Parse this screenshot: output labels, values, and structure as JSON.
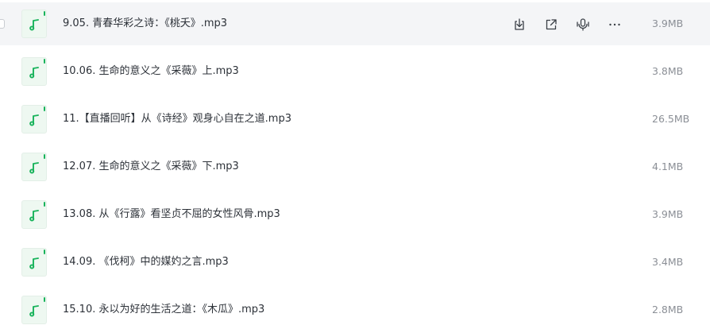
{
  "colors": {
    "accent_green": "#18b35b",
    "icon_bg": "#eef8f1",
    "hover_bg": "#f4f5f7",
    "name_text": "#2c3138",
    "size_text": "#8b8f96"
  },
  "hover_actions": {
    "icons": [
      "download-icon",
      "share-icon",
      "voice-icon",
      "more-icon"
    ]
  },
  "files": [
    {
      "icon": "music-note-icon",
      "name": "9.05. 青春华彩之诗：《桃夭》.mp3",
      "size": "3.9MB",
      "hovered": true
    },
    {
      "icon": "music-note-icon",
      "name": "10.06. 生命的意义之《采薇》上.mp3",
      "size": "3.8MB",
      "hovered": false
    },
    {
      "icon": "music-note-icon",
      "name": "11.【直播回听】从《诗经》观身心自在之道.mp3",
      "size": "26.5MB",
      "hovered": false
    },
    {
      "icon": "music-note-icon",
      "name": "12.07. 生命的意义之《采薇》下.mp3",
      "size": "4.1MB",
      "hovered": false
    },
    {
      "icon": "music-note-icon",
      "name": "13.08. 从《行露》看坚贞不屈的女性风骨.mp3",
      "size": "3.9MB",
      "hovered": false
    },
    {
      "icon": "music-note-icon",
      "name": "14.09. 《伐柯》中的媒妁之言.mp3",
      "size": "3.4MB",
      "hovered": false
    },
    {
      "icon": "music-note-icon",
      "name": "15.10. 永以为好的生活之道：《木瓜》.mp3",
      "size": "2.8MB",
      "hovered": false
    }
  ]
}
